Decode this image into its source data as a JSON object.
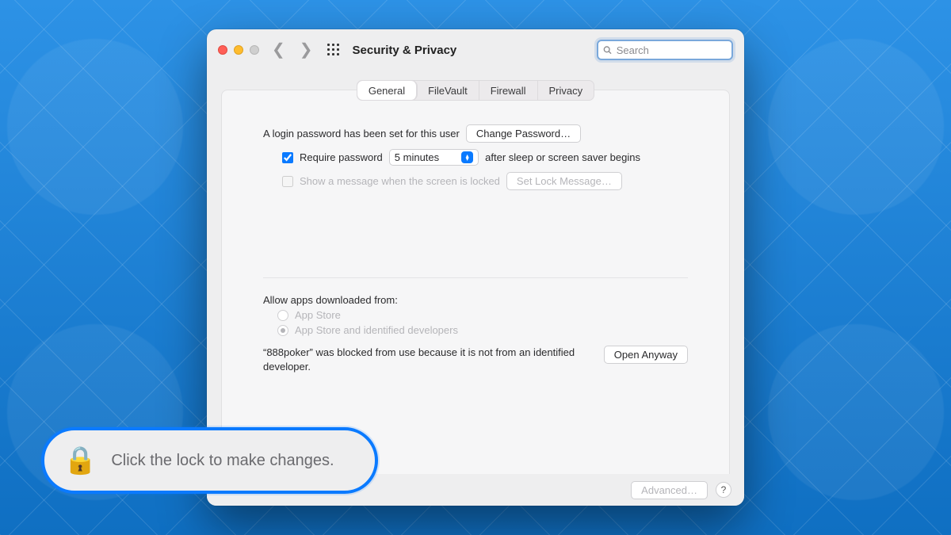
{
  "window": {
    "title": "Security & Privacy"
  },
  "search": {
    "placeholder": "Search"
  },
  "tabs": [
    "General",
    "FileVault",
    "Firewall",
    "Privacy"
  ],
  "general": {
    "login_password_text": "A login password has been set for this user",
    "change_password_btn": "Change Password…",
    "require_password_label": "Require password",
    "require_password_delay": "5 minutes",
    "require_password_after": "after sleep or screen saver begins",
    "show_message_label": "Show a message when the screen is locked",
    "set_lock_message_btn": "Set Lock Message…"
  },
  "downloads": {
    "heading": "Allow apps downloaded from:",
    "option_appstore": "App Store",
    "option_identified": "App Store and identified developers",
    "blocked_msg": "“888poker” was blocked from use because it is not from an identified developer.",
    "open_anyway_btn": "Open Anyway"
  },
  "footer": {
    "advanced_btn": "Advanced…",
    "help": "?"
  },
  "callout": {
    "text": "Click the lock to make changes."
  }
}
